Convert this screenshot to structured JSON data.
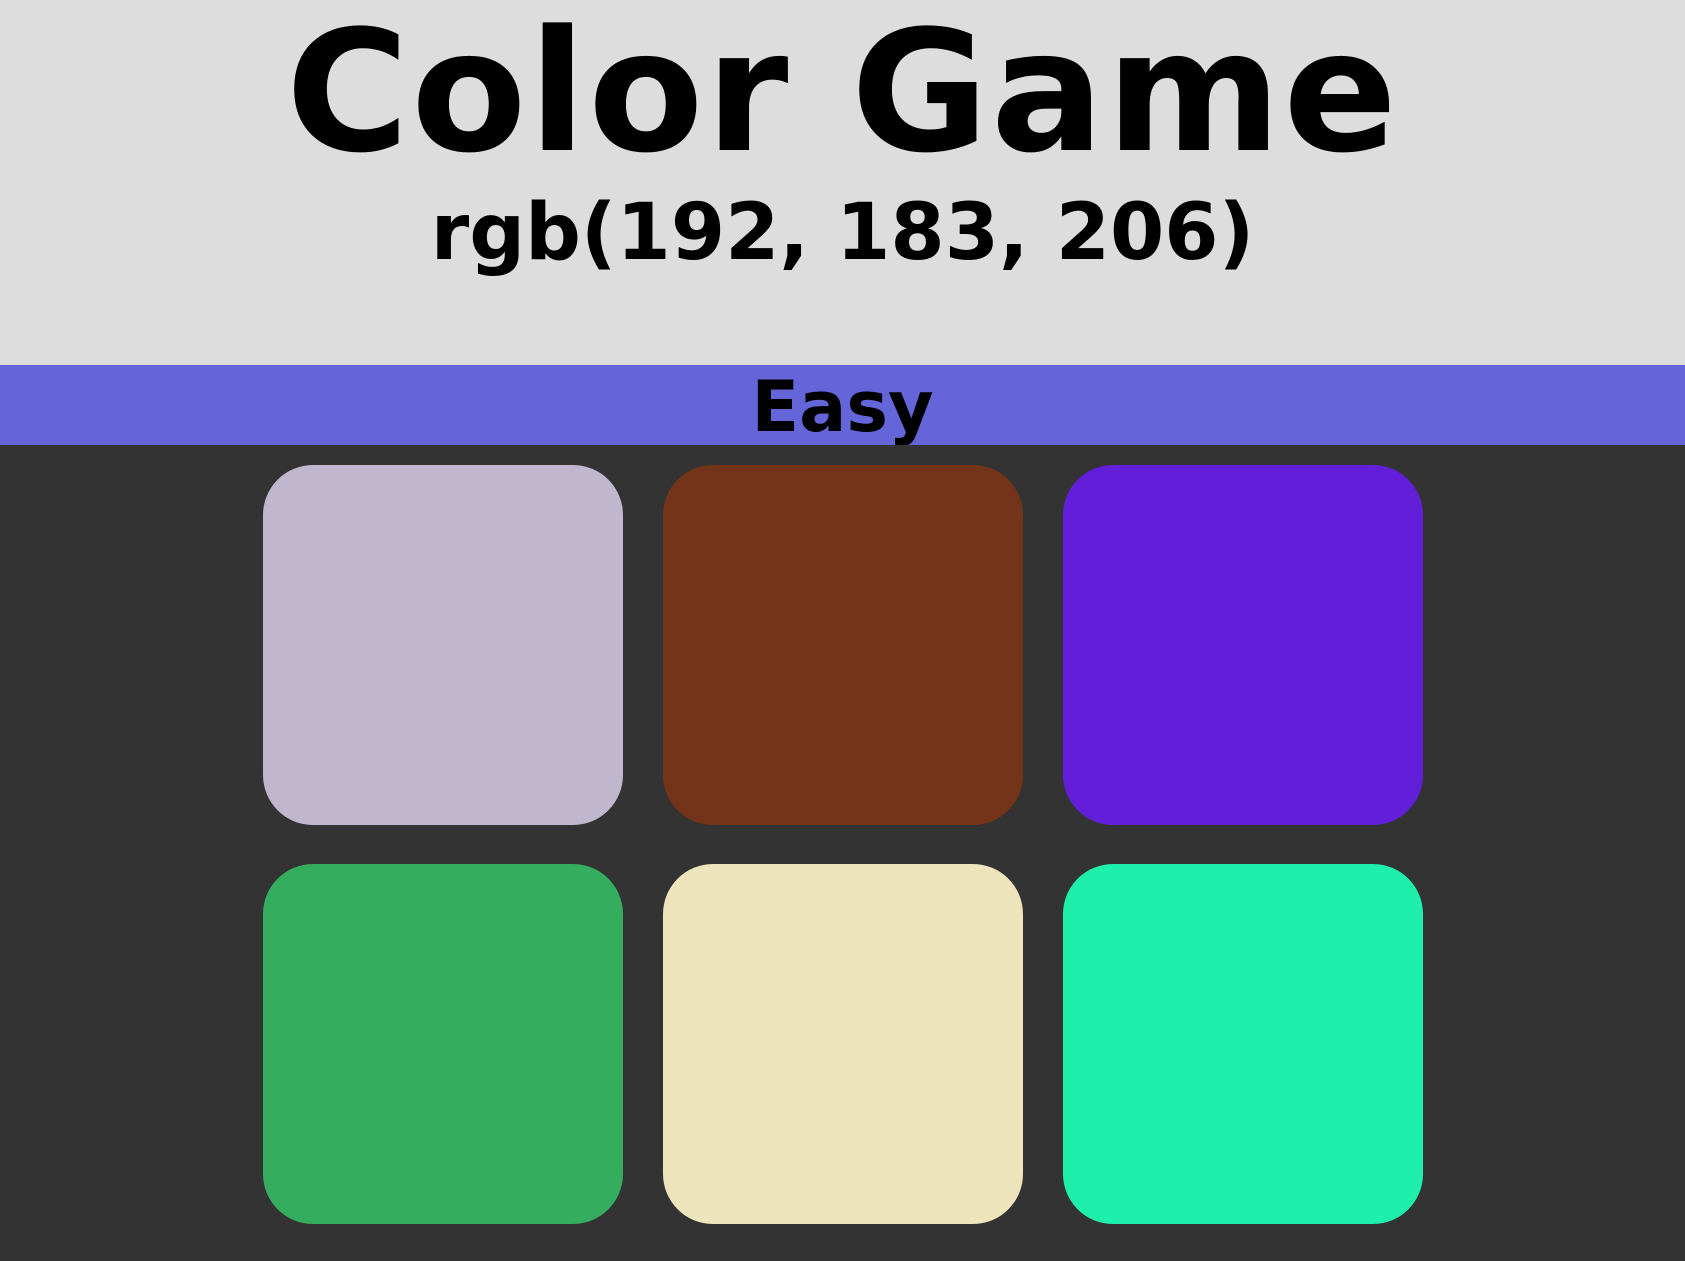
{
  "header": {
    "title": "Color Game",
    "target_color": "rgb(192, 183, 206)",
    "background": "#dddddd"
  },
  "mode_bar": {
    "mode_label": "Easy",
    "background": "#6565da"
  },
  "board": {
    "background": "#333333",
    "squares": [
      {
        "color": "#c0b7ce"
      },
      {
        "color": "#743419"
      },
      {
        "color": "#621ed9"
      },
      {
        "color": "#35ad5f"
      },
      {
        "color": "#ede4bb"
      },
      {
        "color": "#1ef0ac"
      }
    ]
  }
}
